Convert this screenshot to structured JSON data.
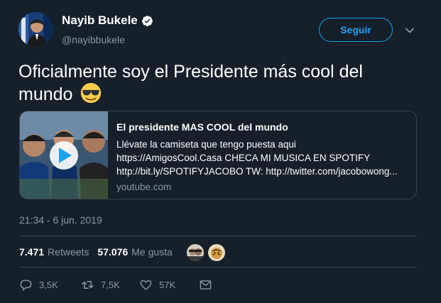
{
  "header": {
    "name": "Nayib Bukele",
    "handle": "@nayibbukele",
    "follow_label": "Seguir"
  },
  "tweet": {
    "text": "Oficialmente soy el Presidente más cool del mundo",
    "emoji": "smiling-face-with-sunglasses"
  },
  "card": {
    "title": "El presidente MAS COOL del mundo",
    "description_lines": [
      "Llévate la camiseta que tengo puesta aqui",
      "https://AmigosCool.Casa CHECA MI MUSICA EN SPOTIFY",
      "http://bit.ly/SPOTIFYJACOBO TW: http://twitter.com/jacobowong..."
    ],
    "domain": "youtube.com"
  },
  "timestamp": "21:34 - 6 jun. 2019",
  "stats": {
    "retweets_count": "7.471",
    "retweets_label": "Retweets",
    "likes_count": "57.076",
    "likes_label": "Me gusta"
  },
  "actions": {
    "reply_count": "3,5K",
    "retweet_count": "7,5K",
    "like_count": "57K"
  },
  "colors": {
    "background": "#15202b",
    "accent": "#1da1f2",
    "muted_text": "#8899a6",
    "border": "#38444d"
  }
}
